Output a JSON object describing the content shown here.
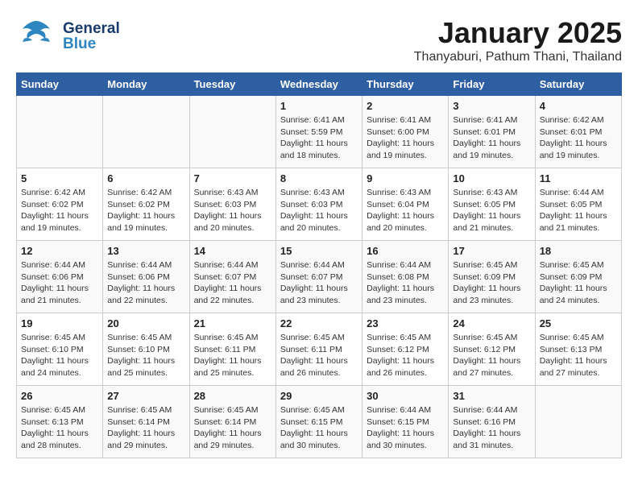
{
  "header": {
    "logo_general": "General",
    "logo_blue": "Blue",
    "month": "January 2025",
    "location": "Thanyaburi, Pathum Thani, Thailand"
  },
  "days_of_week": [
    "Sunday",
    "Monday",
    "Tuesday",
    "Wednesday",
    "Thursday",
    "Friday",
    "Saturday"
  ],
  "weeks": [
    [
      {
        "day": "",
        "text": ""
      },
      {
        "day": "",
        "text": ""
      },
      {
        "day": "",
        "text": ""
      },
      {
        "day": "1",
        "text": "Sunrise: 6:41 AM\nSunset: 5:59 PM\nDaylight: 11 hours and 18 minutes."
      },
      {
        "day": "2",
        "text": "Sunrise: 6:41 AM\nSunset: 6:00 PM\nDaylight: 11 hours and 19 minutes."
      },
      {
        "day": "3",
        "text": "Sunrise: 6:41 AM\nSunset: 6:01 PM\nDaylight: 11 hours and 19 minutes."
      },
      {
        "day": "4",
        "text": "Sunrise: 6:42 AM\nSunset: 6:01 PM\nDaylight: 11 hours and 19 minutes."
      }
    ],
    [
      {
        "day": "5",
        "text": "Sunrise: 6:42 AM\nSunset: 6:02 PM\nDaylight: 11 hours and 19 minutes."
      },
      {
        "day": "6",
        "text": "Sunrise: 6:42 AM\nSunset: 6:02 PM\nDaylight: 11 hours and 19 minutes."
      },
      {
        "day": "7",
        "text": "Sunrise: 6:43 AM\nSunset: 6:03 PM\nDaylight: 11 hours and 20 minutes."
      },
      {
        "day": "8",
        "text": "Sunrise: 6:43 AM\nSunset: 6:03 PM\nDaylight: 11 hours and 20 minutes."
      },
      {
        "day": "9",
        "text": "Sunrise: 6:43 AM\nSunset: 6:04 PM\nDaylight: 11 hours and 20 minutes."
      },
      {
        "day": "10",
        "text": "Sunrise: 6:43 AM\nSunset: 6:05 PM\nDaylight: 11 hours and 21 minutes."
      },
      {
        "day": "11",
        "text": "Sunrise: 6:44 AM\nSunset: 6:05 PM\nDaylight: 11 hours and 21 minutes."
      }
    ],
    [
      {
        "day": "12",
        "text": "Sunrise: 6:44 AM\nSunset: 6:06 PM\nDaylight: 11 hours and 21 minutes."
      },
      {
        "day": "13",
        "text": "Sunrise: 6:44 AM\nSunset: 6:06 PM\nDaylight: 11 hours and 22 minutes."
      },
      {
        "day": "14",
        "text": "Sunrise: 6:44 AM\nSunset: 6:07 PM\nDaylight: 11 hours and 22 minutes."
      },
      {
        "day": "15",
        "text": "Sunrise: 6:44 AM\nSunset: 6:07 PM\nDaylight: 11 hours and 23 minutes."
      },
      {
        "day": "16",
        "text": "Sunrise: 6:44 AM\nSunset: 6:08 PM\nDaylight: 11 hours and 23 minutes."
      },
      {
        "day": "17",
        "text": "Sunrise: 6:45 AM\nSunset: 6:09 PM\nDaylight: 11 hours and 23 minutes."
      },
      {
        "day": "18",
        "text": "Sunrise: 6:45 AM\nSunset: 6:09 PM\nDaylight: 11 hours and 24 minutes."
      }
    ],
    [
      {
        "day": "19",
        "text": "Sunrise: 6:45 AM\nSunset: 6:10 PM\nDaylight: 11 hours and 24 minutes."
      },
      {
        "day": "20",
        "text": "Sunrise: 6:45 AM\nSunset: 6:10 PM\nDaylight: 11 hours and 25 minutes."
      },
      {
        "day": "21",
        "text": "Sunrise: 6:45 AM\nSunset: 6:11 PM\nDaylight: 11 hours and 25 minutes."
      },
      {
        "day": "22",
        "text": "Sunrise: 6:45 AM\nSunset: 6:11 PM\nDaylight: 11 hours and 26 minutes."
      },
      {
        "day": "23",
        "text": "Sunrise: 6:45 AM\nSunset: 6:12 PM\nDaylight: 11 hours and 26 minutes."
      },
      {
        "day": "24",
        "text": "Sunrise: 6:45 AM\nSunset: 6:12 PM\nDaylight: 11 hours and 27 minutes."
      },
      {
        "day": "25",
        "text": "Sunrise: 6:45 AM\nSunset: 6:13 PM\nDaylight: 11 hours and 27 minutes."
      }
    ],
    [
      {
        "day": "26",
        "text": "Sunrise: 6:45 AM\nSunset: 6:13 PM\nDaylight: 11 hours and 28 minutes."
      },
      {
        "day": "27",
        "text": "Sunrise: 6:45 AM\nSunset: 6:14 PM\nDaylight: 11 hours and 29 minutes."
      },
      {
        "day": "28",
        "text": "Sunrise: 6:45 AM\nSunset: 6:14 PM\nDaylight: 11 hours and 29 minutes."
      },
      {
        "day": "29",
        "text": "Sunrise: 6:45 AM\nSunset: 6:15 PM\nDaylight: 11 hours and 30 minutes."
      },
      {
        "day": "30",
        "text": "Sunrise: 6:44 AM\nSunset: 6:15 PM\nDaylight: 11 hours and 30 minutes."
      },
      {
        "day": "31",
        "text": "Sunrise: 6:44 AM\nSunset: 6:16 PM\nDaylight: 11 hours and 31 minutes."
      },
      {
        "day": "",
        "text": ""
      }
    ]
  ]
}
